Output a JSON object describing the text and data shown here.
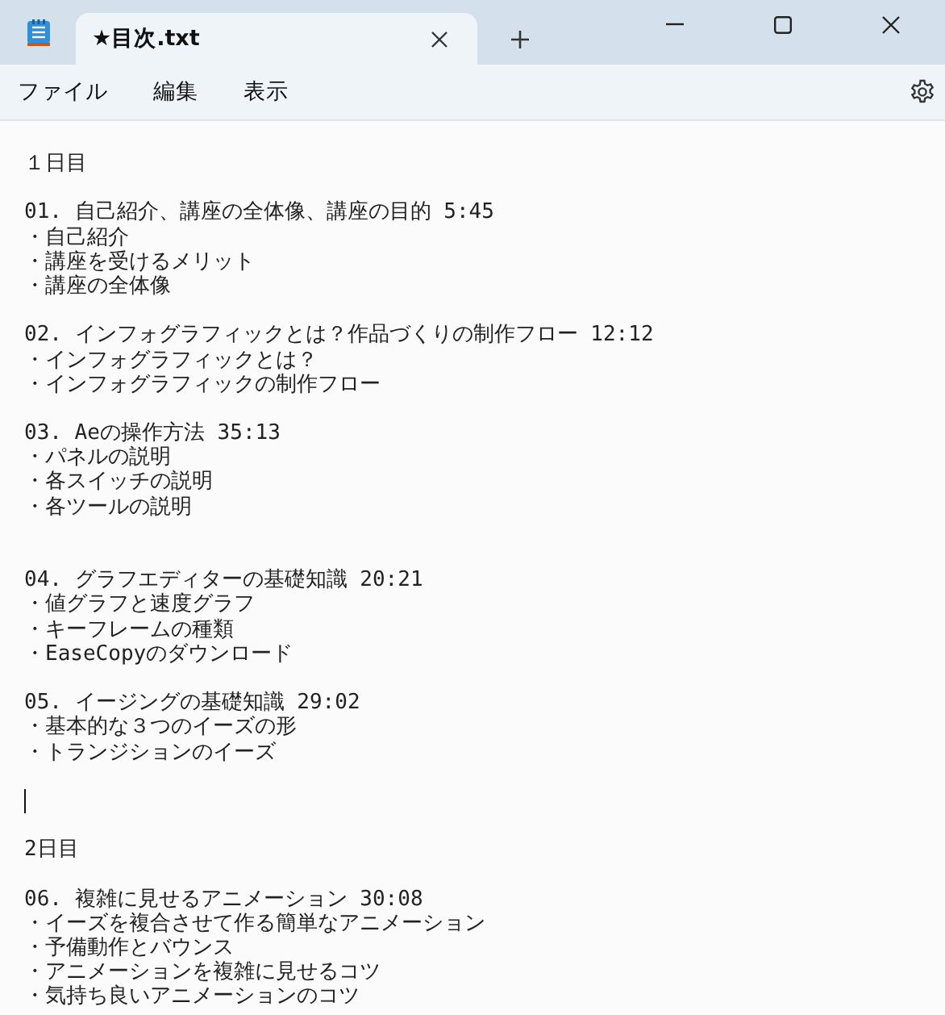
{
  "tabs": [
    {
      "title": "★目次.txt",
      "selected": true
    }
  ],
  "menu": [
    "ファイル",
    "編集",
    "表示"
  ],
  "lines": [
    {
      "kind": "text",
      "text": "１日目"
    },
    {
      "kind": "blank"
    },
    {
      "kind": "text",
      "text": "01. 自己紹介、講座の全体像、講座の目的 5:45"
    },
    {
      "kind": "text",
      "text": "・自己紹介"
    },
    {
      "kind": "text",
      "text": "・講座を受けるメリット"
    },
    {
      "kind": "text",
      "text": "・講座の全体像"
    },
    {
      "kind": "blank"
    },
    {
      "kind": "text",
      "text": "02. インフォグラフィックとは？作品づくりの制作フロー 12:12"
    },
    {
      "kind": "text",
      "text": "・インフォグラフィックとは？"
    },
    {
      "kind": "text",
      "text": "・インフォグラフィックの制作フロー"
    },
    {
      "kind": "blank"
    },
    {
      "kind": "text",
      "text": "03. Aeの操作方法 35:13"
    },
    {
      "kind": "text",
      "text": "・パネルの説明"
    },
    {
      "kind": "text",
      "text": "・各スイッチの説明"
    },
    {
      "kind": "text",
      "text": "・各ツールの説明"
    },
    {
      "kind": "blank"
    },
    {
      "kind": "blank"
    },
    {
      "kind": "text",
      "text": "04. グラフエディターの基礎知識 20:21"
    },
    {
      "kind": "text",
      "text": "・値グラフと速度グラフ"
    },
    {
      "kind": "text",
      "text": "・キーフレームの種類"
    },
    {
      "kind": "text",
      "text": "・EaseCopyのダウンロード"
    },
    {
      "kind": "blank"
    },
    {
      "kind": "text",
      "text": "05. イージングの基礎知識 29:02"
    },
    {
      "kind": "text",
      "text": "・基本的な３つのイーズの形"
    },
    {
      "kind": "text",
      "text": "・トランジションのイーズ"
    },
    {
      "kind": "blank"
    },
    {
      "kind": "caret"
    },
    {
      "kind": "blank"
    },
    {
      "kind": "text",
      "text": "2日目"
    },
    {
      "kind": "blank"
    },
    {
      "kind": "text",
      "text": "06. 複雑に見せるアニメーション 30:08"
    },
    {
      "kind": "text",
      "text": "・イーズを複合させて作る簡単なアニメーション"
    },
    {
      "kind": "text",
      "text": "・予備動作とバウンス"
    },
    {
      "kind": "text",
      "text": "・アニメーションを複雑に見せるコツ"
    },
    {
      "kind": "text",
      "text": "・気持ち良いアニメーションのコツ"
    }
  ]
}
